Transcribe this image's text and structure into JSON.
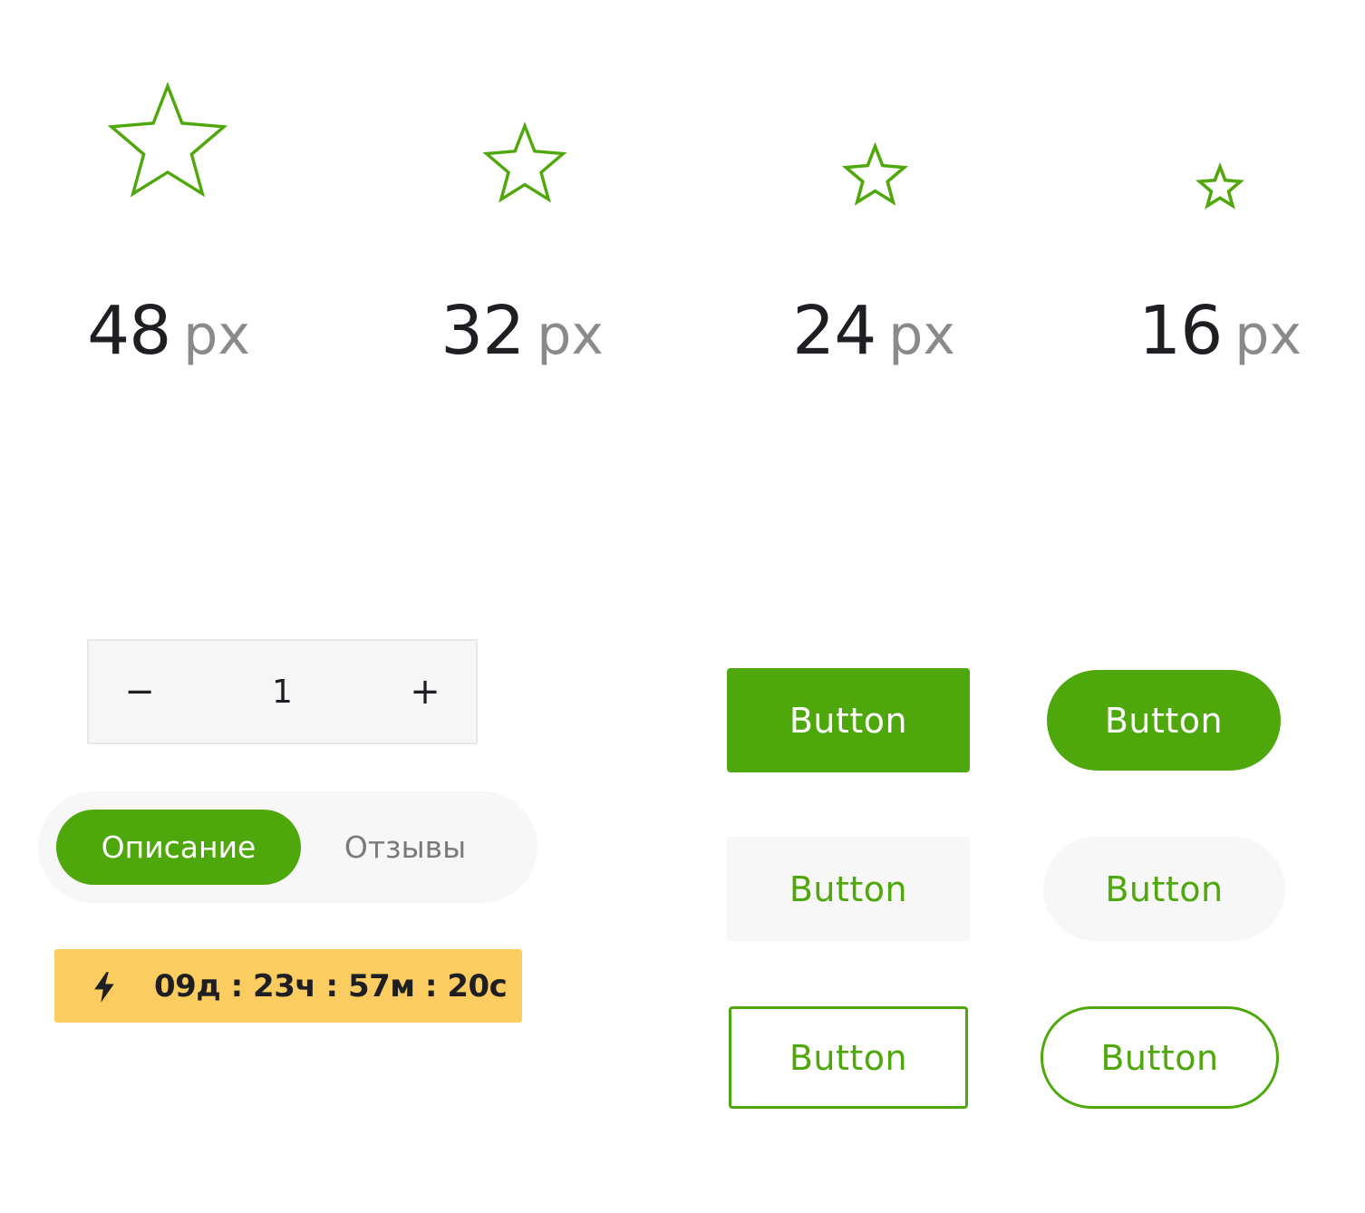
{
  "colors": {
    "accent": "#4fa80b",
    "timer_bg": "#fbcc5f",
    "text_dark": "#1f1f23",
    "text_muted": "#8a8a8a",
    "light_bg": "#f7f7f7"
  },
  "icon_sizes": [
    {
      "icon": "star-outline-icon",
      "value": "48",
      "unit": "px"
    },
    {
      "icon": "star-outline-icon",
      "value": "32",
      "unit": "px"
    },
    {
      "icon": "star-outline-icon",
      "value": "24",
      "unit": "px"
    },
    {
      "icon": "star-outline-icon",
      "value": "16",
      "unit": "px"
    }
  ],
  "stepper": {
    "minus_label": "−",
    "quantity": "1",
    "plus_label": "+"
  },
  "tabs": [
    {
      "label": "Описание",
      "active": true
    },
    {
      "label": "Отзывы",
      "active": false
    }
  ],
  "timer": {
    "icon": "lightning-icon",
    "text": "09д : 23ч : 57м : 20с"
  },
  "buttons": {
    "filled_rect": "Button",
    "filled_pill": "Button",
    "light_rect": "Button",
    "light_pill": "Button",
    "outline_rect": "Button",
    "outline_pill": "Button"
  }
}
